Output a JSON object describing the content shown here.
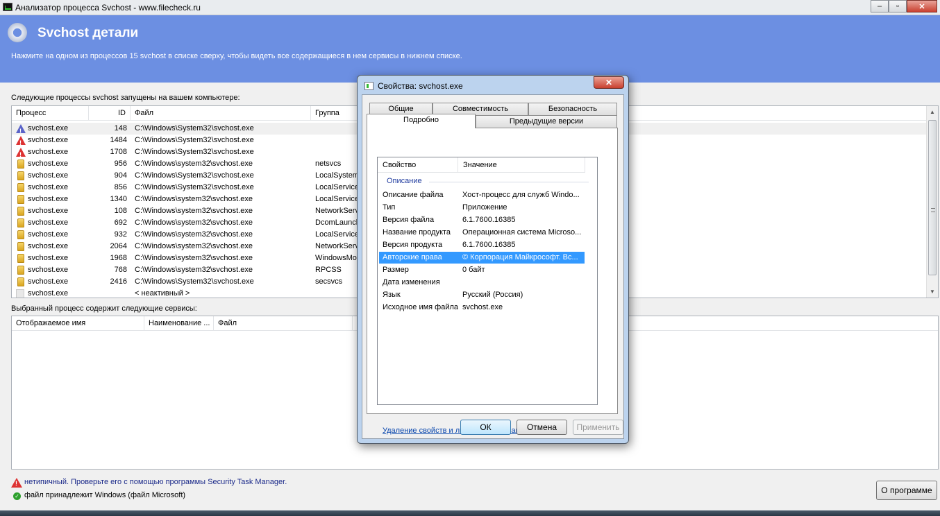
{
  "window": {
    "title": "Анализатор процесса Svchost - www.filecheck.ru",
    "minimize": "–",
    "maximize": "▫",
    "close": "✕"
  },
  "header": {
    "title": "Svchost детали",
    "subtitle": "Нажмите на одном из процессов 15 svchost в списке сверху, чтобы видеть все содержащиеся в нем сервисы в нижнем списке."
  },
  "processes": {
    "label": "Следующие процессы svchost запущены на вашем компьютере:",
    "columns": [
      "Процесс",
      "ID",
      "Файл",
      "Группа"
    ],
    "rows": [
      {
        "icon": "warning-blue-icon",
        "name": "svchost.exe",
        "id": "148",
        "file": "C:\\Windows\\System32\\svchost.exe",
        "group": ""
      },
      {
        "icon": "warning-icon",
        "name": "svchost.exe",
        "id": "1484",
        "file": "C:\\Windows\\System32\\svchost.exe",
        "group": ""
      },
      {
        "icon": "warning-icon",
        "name": "svchost.exe",
        "id": "1708",
        "file": "C:\\Windows\\System32\\svchost.exe",
        "group": ""
      },
      {
        "icon": "folder-icon",
        "name": "svchost.exe",
        "id": "956",
        "file": "C:\\Windows\\system32\\svchost.exe",
        "group": "netsvcs"
      },
      {
        "icon": "folder-icon",
        "name": "svchost.exe",
        "id": "904",
        "file": "C:\\Windows\\System32\\svchost.exe",
        "group": "LocalSystem"
      },
      {
        "icon": "folder-icon",
        "name": "svchost.exe",
        "id": "856",
        "file": "C:\\Windows\\System32\\svchost.exe",
        "group": "LocalService"
      },
      {
        "icon": "folder-icon",
        "name": "svchost.exe",
        "id": "1340",
        "file": "C:\\Windows\\system32\\svchost.exe",
        "group": "LocalService"
      },
      {
        "icon": "folder-icon",
        "name": "svchost.exe",
        "id": "108",
        "file": "C:\\Windows\\system32\\svchost.exe",
        "group": "NetworkServ"
      },
      {
        "icon": "folder-icon",
        "name": "svchost.exe",
        "id": "692",
        "file": "C:\\Windows\\system32\\svchost.exe",
        "group": "DcomLaunch"
      },
      {
        "icon": "folder-icon",
        "name": "svchost.exe",
        "id": "932",
        "file": "C:\\Windows\\system32\\svchost.exe",
        "group": "LocalService"
      },
      {
        "icon": "folder-icon",
        "name": "svchost.exe",
        "id": "2064",
        "file": "C:\\Windows\\system32\\svchost.exe",
        "group": "NetworkServ"
      },
      {
        "icon": "folder-icon",
        "name": "svchost.exe",
        "id": "1968",
        "file": "C:\\Windows\\system32\\svchost.exe",
        "group": "WindowsMo"
      },
      {
        "icon": "folder-icon",
        "name": "svchost.exe",
        "id": "768",
        "file": "C:\\Windows\\system32\\svchost.exe",
        "group": "RPCSS"
      },
      {
        "icon": "folder-icon",
        "name": "svchost.exe",
        "id": "2416",
        "file": "C:\\Windows\\System32\\svchost.exe",
        "group": "secsvcs"
      },
      {
        "icon": "blank-icon",
        "name": "svchost.exe",
        "id": "",
        "file": "< неактивный >",
        "group": ""
      }
    ]
  },
  "services": {
    "label": "Выбранный процесс содержит следующие сервисы:",
    "columns": [
      "Отображаемое имя",
      "Наименование ...",
      "Файл"
    ]
  },
  "legend": {
    "warning_text": "нетипичный. Проверьте его с помощью программы Security Task Manager.",
    "ok_text": "файл принадлежит Windows (файл Microsoft)"
  },
  "about_button": "О программе",
  "dialog": {
    "title": "Свойства: svchost.exe",
    "close": "✕",
    "tabs_row1": [
      "Общие",
      "Совместимость",
      "Безопасность"
    ],
    "tabs_row2": [
      "Подробно",
      "Предыдущие версии"
    ],
    "active_tab": "Подробно",
    "columns": [
      "Свойство",
      "Значение"
    ],
    "group": "Описание",
    "properties": [
      {
        "key": "Описание файла",
        "value": "Хост-процесс для служб Windo..."
      },
      {
        "key": "Тип",
        "value": "Приложение"
      },
      {
        "key": "Версия файла",
        "value": "6.1.7600.16385"
      },
      {
        "key": "Название продукта",
        "value": "Операционная система Microso..."
      },
      {
        "key": "Версия продукта",
        "value": "6.1.7600.16385"
      },
      {
        "key": "Авторские права",
        "value": "© Корпорация Майкрософт. Вс..."
      },
      {
        "key": "Размер",
        "value": "0 байт"
      },
      {
        "key": "Дата изменения",
        "value": ""
      },
      {
        "key": "Язык",
        "value": "Русский (Россия)"
      },
      {
        "key": "Исходное имя файла",
        "value": "svchost.exe"
      }
    ],
    "selected_property": "Авторские права",
    "link": "Удаление свойств и личной информации",
    "ok": "ОК",
    "cancel": "Отмена",
    "apply": "Применить"
  }
}
